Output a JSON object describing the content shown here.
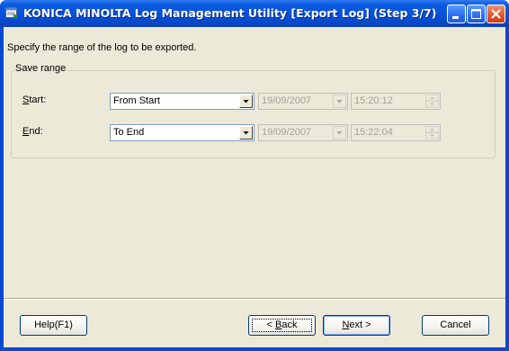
{
  "window": {
    "title": "KONICA MINOLTA Log Management Utility [Export Log] (Step 3/7)"
  },
  "instruction": "Specify the range of the log to be exported.",
  "save_range": {
    "group_title": "Save range",
    "start": {
      "label_access_key": "S",
      "label_rest": "tart:",
      "combo_value": "From Start",
      "date": "19/09/2007",
      "time": "15:20:12"
    },
    "end": {
      "label_access_key": "E",
      "label_rest": "nd:",
      "combo_value": "To End",
      "date": "19/09/2007",
      "time": "15:22:04"
    }
  },
  "buttons": {
    "help": "Help(F1)",
    "back_prefix": "< ",
    "back_key": "B",
    "back_rest": "ack",
    "next_key": "N",
    "next_rest": "ext >",
    "cancel": "Cancel"
  },
  "icons": {
    "app": "app-window-icon",
    "minimize": "minimize-icon",
    "maximize": "maximize-icon",
    "close": "close-icon",
    "dropdown": "chevron-down-icon",
    "spinner": "spinner-icon"
  },
  "colors": {
    "title_bar": "#0752dc",
    "dialog_bg": "#ece9d8",
    "close_button": "#e05a30",
    "disabled_text": "#a3a29a"
  }
}
